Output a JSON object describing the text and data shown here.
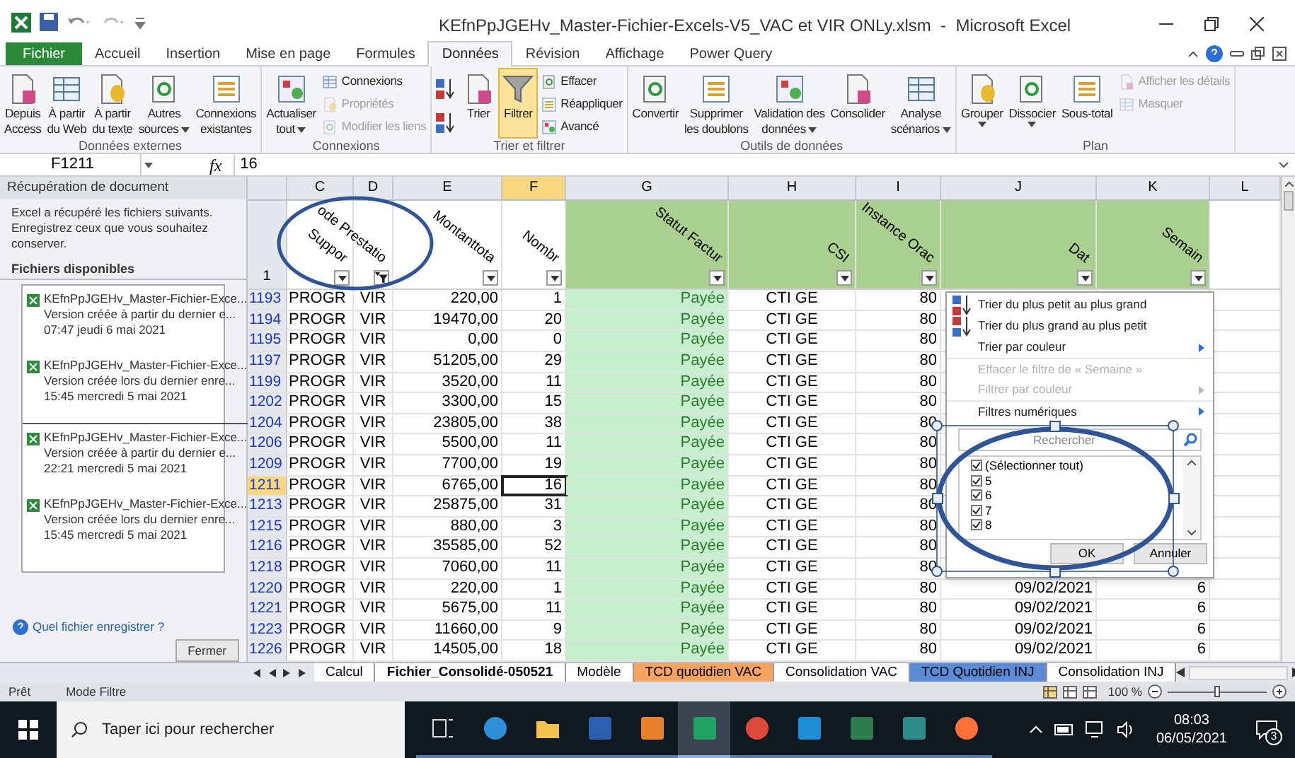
{
  "window": {
    "title": "KEfnPpJGEHv_Master-Fichier-Excels-V5_VAC et VIR ONLy.xlsm  -  Microsoft Excel"
  },
  "ribbon_tabs": [
    {
      "label": "Fichier",
      "selected": false,
      "kind": "file"
    },
    {
      "label": "Accueil",
      "selected": false,
      "kind": "tab"
    },
    {
      "label": "Insertion",
      "selected": false,
      "kind": "tab"
    },
    {
      "label": "Mise en page",
      "selected": false,
      "kind": "tab"
    },
    {
      "label": "Formules",
      "selected": false,
      "kind": "tab"
    },
    {
      "label": "Données",
      "selected": true,
      "kind": "tab"
    },
    {
      "label": "Révision",
      "selected": false,
      "kind": "tab"
    },
    {
      "label": "Affichage",
      "selected": false,
      "kind": "tab"
    },
    {
      "label": "Power Query",
      "selected": false,
      "kind": "tab"
    }
  ],
  "ribbon_groups": [
    {
      "label": "Données externes",
      "buttons": [
        {
          "kind": "large",
          "lines": [
            "Depuis",
            "Access"
          ],
          "dropdown": false,
          "disabled": false,
          "on": false
        },
        {
          "kind": "large",
          "lines": [
            "À partir",
            "du Web"
          ],
          "dropdown": false,
          "disabled": false,
          "on": false
        },
        {
          "kind": "large",
          "lines": [
            "À partir",
            "du texte"
          ],
          "dropdown": false,
          "disabled": false,
          "on": false
        },
        {
          "kind": "large",
          "lines": [
            "Autres",
            "sources"
          ],
          "dropdown": true,
          "disabled": false,
          "on": false
        },
        {
          "kind": "large",
          "lines": [
            "Connexions",
            "existantes"
          ],
          "dropdown": false,
          "disabled": false,
          "on": false
        }
      ]
    },
    {
      "label": "Connexions",
      "buttons": [
        {
          "kind": "large",
          "lines": [
            "Actualiser",
            "tout"
          ],
          "dropdown": true,
          "disabled": false,
          "on": false
        },
        {
          "kind": "small",
          "lines": [
            "Connexions"
          ],
          "dropdown": false,
          "disabled": false,
          "on": false
        },
        {
          "kind": "small",
          "lines": [
            "Propriétés"
          ],
          "dropdown": false,
          "disabled": true,
          "on": false
        },
        {
          "kind": "small",
          "lines": [
            "Modifier les liens"
          ],
          "dropdown": false,
          "disabled": true,
          "on": false
        }
      ]
    },
    {
      "label": "Trier et filtrer",
      "buttons": [
        {
          "kind": "icon",
          "dropdown": false,
          "disabled": false,
          "on": false
        },
        {
          "kind": "icon",
          "dropdown": false,
          "disabled": false,
          "on": false
        },
        {
          "kind": "large",
          "lines": [
            "Trier"
          ],
          "dropdown": false,
          "disabled": false,
          "on": false
        },
        {
          "kind": "large",
          "lines": [
            "Filtrer"
          ],
          "dropdown": false,
          "disabled": false,
          "on": true
        },
        {
          "kind": "small",
          "lines": [
            "Effacer"
          ],
          "dropdown": false,
          "disabled": false,
          "on": false
        },
        {
          "kind": "small",
          "lines": [
            "Réappliquer"
          ],
          "dropdown": false,
          "disabled": false,
          "on": false
        },
        {
          "kind": "small",
          "lines": [
            "Avancé"
          ],
          "dropdown": false,
          "disabled": false,
          "on": false
        }
      ]
    },
    {
      "label": "Outils de données",
      "buttons": [
        {
          "kind": "large",
          "lines": [
            "Convertir"
          ],
          "dropdown": false,
          "disabled": false,
          "on": false
        },
        {
          "kind": "large",
          "lines": [
            "Supprimer",
            "les doublons"
          ],
          "dropdown": false,
          "disabled": false,
          "on": false
        },
        {
          "kind": "large",
          "lines": [
            "Validation des",
            "données"
          ],
          "dropdown": true,
          "disabled": false,
          "on": false
        },
        {
          "kind": "large",
          "lines": [
            "Consolider"
          ],
          "dropdown": false,
          "disabled": false,
          "on": false
        },
        {
          "kind": "large",
          "lines": [
            "Analyse",
            "scénarios"
          ],
          "dropdown": true,
          "disabled": false,
          "on": false
        }
      ]
    },
    {
      "label": "Plan",
      "buttons": [
        {
          "kind": "large",
          "lines": [
            "Grouper"
          ],
          "dropdown": true,
          "disabled": false,
          "on": false
        },
        {
          "kind": "large",
          "lines": [
            "Dissocier"
          ],
          "dropdown": true,
          "disabled": false,
          "on": false
        },
        {
          "kind": "large",
          "lines": [
            "Sous-total"
          ],
          "dropdown": false,
          "disabled": false,
          "on": false
        },
        {
          "kind": "small",
          "lines": [
            "Afficher les détails"
          ],
          "dropdown": false,
          "disabled": true,
          "on": false
        },
        {
          "kind": "small",
          "lines": [
            "Masquer"
          ],
          "dropdown": false,
          "disabled": true,
          "on": false
        }
      ]
    }
  ],
  "formula_bar": {
    "name_box": "F1211",
    "function_label": "fx",
    "value": "16"
  },
  "recovery_pane": {
    "title": "Récupération de document",
    "message": "Excel a récupéré les fichiers suivants. Enregistrez ceux que vous souhaitez conserver.",
    "section_title": "Fichiers disponibles",
    "files": [
      {
        "name": "KEfnPpJGEHv_Master-Fichier-Exce...",
        "description": "Version créée à partir du dernier e...",
        "time": "07:47 jeudi 6 mai 2021"
      },
      {
        "name": "KEfnPpJGEHv_Master-Fichier-Exce...",
        "description": "Version créée lors du dernier enre...",
        "time": "15:45 mercredi 5 mai 2021"
      },
      {
        "name": "KEfnPpJGEHv_Master-Fichier-Exce...",
        "description": "Version créée à partir du dernier e...",
        "time": "22:21 mercredi 5 mai 2021"
      },
      {
        "name": "KEfnPpJGEHv_Master-Fichier-Exce...",
        "description": "Version créée lors du dernier enre...",
        "time": "15:45 mercredi 5 mai 2021"
      }
    ],
    "help_link": "Quel fichier enregistrer ?",
    "close_button": "Fermer"
  },
  "grid": {
    "header_row_number": "1",
    "columns": [
      {
        "letter": "C",
        "header": "Suppor",
        "filter": true,
        "filter_active": false,
        "selected": false
      },
      {
        "letter": "D",
        "header": "ode Prestatio",
        "filter": true,
        "filter_active": true,
        "selected": false
      },
      {
        "letter": "E",
        "header": "Montanttota",
        "filter": true,
        "filter_active": false,
        "selected": false
      },
      {
        "letter": "F",
        "header": "Nombr",
        "filter": true,
        "filter_active": false,
        "selected": true
      },
      {
        "letter": "G",
        "header": "Statut Factur",
        "filter": true,
        "filter_active": false,
        "selected": false
      },
      {
        "letter": "H",
        "header": "CSI",
        "filter": true,
        "filter_active": false,
        "selected": false
      },
      {
        "letter": "I",
        "header": "Instance Orac",
        "filter": true,
        "filter_active": false,
        "selected": false
      },
      {
        "letter": "J",
        "header": "Dat",
        "filter": true,
        "filter_active": false,
        "selected": false
      },
      {
        "letter": "K",
        "header": "Semain",
        "filter": true,
        "filter_active": false,
        "selected": false
      },
      {
        "letter": "L",
        "selected": false
      }
    ],
    "rows": [
      {
        "number": "1193",
        "selected": false,
        "cells": [
          "PROGR",
          "VIR",
          "220,00",
          "1",
          "Payée",
          "CTI GE",
          "80"
        ]
      },
      {
        "number": "1194",
        "selected": false,
        "cells": [
          "PROGR",
          "VIR",
          "19470,00",
          "20",
          "Payée",
          "CTI GE",
          "80"
        ]
      },
      {
        "number": "1195",
        "selected": false,
        "cells": [
          "PROGR",
          "VIR",
          "0,00",
          "0",
          "Payée",
          "CTI GE",
          "80"
        ]
      },
      {
        "number": "1197",
        "selected": false,
        "cells": [
          "PROGR",
          "VIR",
          "51205,00",
          "29",
          "Payée",
          "CTI GE",
          "80"
        ]
      },
      {
        "number": "1199",
        "selected": false,
        "cells": [
          "PROGR",
          "VIR",
          "3520,00",
          "11",
          "Payée",
          "CTI GE",
          "80"
        ]
      },
      {
        "number": "1202",
        "selected": false,
        "cells": [
          "PROGR",
          "VIR",
          "3300,00",
          "15",
          "Payée",
          "CTI GE",
          "80"
        ]
      },
      {
        "number": "1204",
        "selected": false,
        "cells": [
          "PROGR",
          "VIR",
          "23805,00",
          "38",
          "Payée",
          "CTI GE",
          "80"
        ]
      },
      {
        "number": "1206",
        "selected": false,
        "cells": [
          "PROGR",
          "VIR",
          "5500,00",
          "11",
          "Payée",
          "CTI GE",
          "80"
        ]
      },
      {
        "number": "1209",
        "selected": false,
        "cells": [
          "PROGR",
          "VIR",
          "7700,00",
          "19",
          "Payée",
          "CTI GE",
          "80"
        ]
      },
      {
        "number": "1211",
        "selected": true,
        "cells": [
          "PROGR",
          "VIR",
          "6765,00",
          "16",
          "Payée",
          "CTI GE",
          "80"
        ]
      },
      {
        "number": "1213",
        "selected": false,
        "cells": [
          "PROGR",
          "VIR",
          "25875,00",
          "31",
          "Payée",
          "CTI GE",
          "80"
        ]
      },
      {
        "number": "1215",
        "selected": false,
        "cells": [
          "PROGR",
          "VIR",
          "880,00",
          "3",
          "Payée",
          "CTI GE",
          "80"
        ]
      },
      {
        "number": "1216",
        "selected": false,
        "cells": [
          "PROGR",
          "VIR",
          "35585,00",
          "52",
          "Payée",
          "CTI GE",
          "80"
        ]
      },
      {
        "number": "1218",
        "selected": false,
        "cells": [
          "PROGR",
          "VIR",
          "7060,00",
          "11",
          "Payée",
          "CTI GE",
          "80"
        ]
      },
      {
        "number": "1220",
        "selected": false,
        "cells": [
          "PROGR",
          "VIR",
          "220,00",
          "1",
          "Payée",
          "CTI GE",
          "80",
          "09/02/2021",
          "6"
        ]
      },
      {
        "number": "1221",
        "selected": false,
        "cells": [
          "PROGR",
          "VIR",
          "5675,00",
          "11",
          "Payée",
          "CTI GE",
          "80",
          "09/02/2021",
          "6"
        ]
      },
      {
        "number": "1223",
        "selected": false,
        "cells": [
          "PROGR",
          "VIR",
          "11660,00",
          "9",
          "Payée",
          "CTI GE",
          "80",
          "09/02/2021",
          "6"
        ]
      },
      {
        "number": "1226",
        "selected": false,
        "cells": [
          "PROGR",
          "VIR",
          "14505,00",
          "18",
          "Payée",
          "CTI GE",
          "80",
          "09/02/2021",
          "6"
        ]
      }
    ]
  },
  "filter_menu": {
    "items": [
      {
        "label": "Trier du plus petit au plus grand",
        "disabled": false,
        "submenu": false
      },
      {
        "label": "Trier du plus grand au plus petit",
        "disabled": false,
        "submenu": false
      },
      {
        "label": "Trier par couleur",
        "disabled": false,
        "submenu": true
      },
      {
        "label": "Effacer le filtre de « Semaine »",
        "disabled": true,
        "submenu": false
      },
      {
        "label": "Filtrer par couleur",
        "disabled": true,
        "submenu": true
      },
      {
        "label": "Filtres numériques",
        "disabled": false,
        "submenu": true
      }
    ],
    "search": {
      "placeholder": "Rechercher"
    },
    "checklist": [
      {
        "label": "(Sélectionner tout)",
        "checked": true
      },
      {
        "label": "5",
        "checked": true
      },
      {
        "label": "6",
        "checked": true
      },
      {
        "label": "7",
        "checked": true
      },
      {
        "label": "8",
        "checked": true
      }
    ],
    "buttons": [
      "OK",
      "Annuler"
    ]
  },
  "sheet_tabs": [
    {
      "label": "Calcul",
      "selected": false,
      "color": "#ffffff"
    },
    {
      "label": "Fichier_Consolidé-050521",
      "selected": true,
      "color": "#ffffff"
    },
    {
      "label": "Modèle",
      "selected": false,
      "color": "#ffffff"
    },
    {
      "label": "TCD quotidien VAC",
      "selected": false,
      "color": "#f4a460"
    },
    {
      "label": "Consolidation VAC",
      "selected": false,
      "color": "#ffffff"
    },
    {
      "label": "TCD Quotidien INJ",
      "selected": false,
      "color": "#5b8bd6"
    },
    {
      "label": "Consolidation INJ",
      "selected": false,
      "color": "#ffffff"
    }
  ],
  "status_bar": {
    "items": [
      "Prêt",
      "Mode Filtre"
    ],
    "zoom": "100 %",
    "zoom_slider": {
      "level": 0.5
    }
  },
  "taskbar": {
    "search_placeholder": "Taper ici pour rechercher",
    "apps": [
      {
        "selected": false
      },
      {
        "selected": false
      },
      {
        "selected": false
      },
      {
        "selected": false
      },
      {
        "selected": false
      },
      {
        "selected": true
      },
      {
        "selected": false
      },
      {
        "selected": false
      },
      {
        "selected": false
      },
      {
        "selected": false
      },
      {
        "selected": false
      }
    ],
    "time": "08:03",
    "date": "06/05/2021",
    "notifications": "3"
  }
}
